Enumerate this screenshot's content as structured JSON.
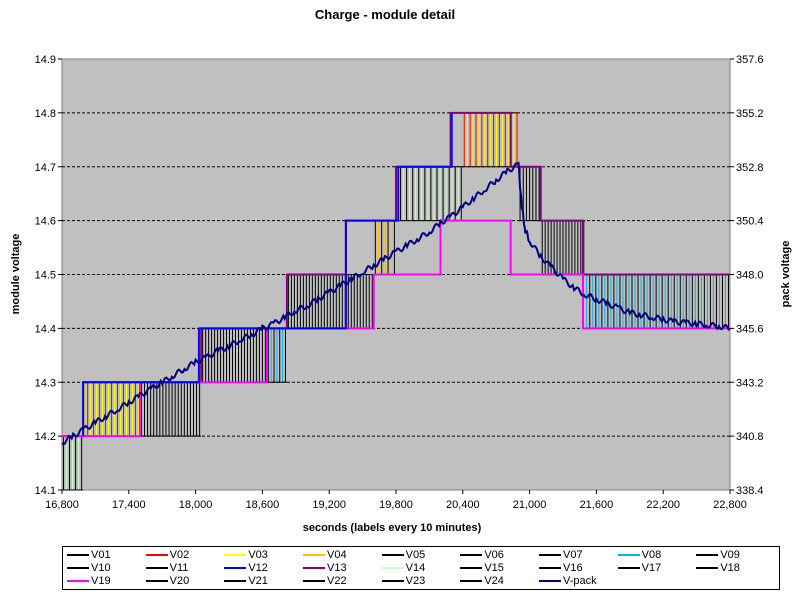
{
  "chart_data": {
    "type": "line",
    "title": "Charge - module detail",
    "xlabel": "seconds (labels every 10 minutes)",
    "ylabel": "module voltage",
    "y2label": "pack voltage",
    "xlim": [
      16800,
      22800
    ],
    "ylim": [
      14.1,
      14.9
    ],
    "y2lim": [
      338.4,
      357.6
    ],
    "x_ticks": [
      "16,800",
      "17,400",
      "18,000",
      "18,600",
      "19,200",
      "19,800",
      "20,400",
      "21,000",
      "21,600",
      "22,200",
      "22,800"
    ],
    "y_ticks": [
      "14.1",
      "14.2",
      "14.3",
      "14.4",
      "14.5",
      "14.6",
      "14.7",
      "14.8",
      "14.9"
    ],
    "y2_ticks": [
      "338.4",
      "340.8",
      "343.2",
      "345.6",
      "348.0",
      "350.4",
      "352.8",
      "355.2",
      "357.6"
    ],
    "grid": "horizontal dashed",
    "background": "#c0c0c0",
    "legend_position": "bottom",
    "series": [
      {
        "name": "V01",
        "color": "#000000"
      },
      {
        "name": "V02",
        "color": "#ff0000"
      },
      {
        "name": "V03",
        "color": "#ffff00"
      },
      {
        "name": "V04",
        "color": "#ffc000"
      },
      {
        "name": "V05",
        "color": "#000000"
      },
      {
        "name": "V06",
        "color": "#000000"
      },
      {
        "name": "V07",
        "color": "#000000"
      },
      {
        "name": "V08",
        "color": "#00b0f0"
      },
      {
        "name": "V09",
        "color": "#000000"
      },
      {
        "name": "V10",
        "color": "#000000"
      },
      {
        "name": "V11",
        "color": "#000000"
      },
      {
        "name": "V12",
        "color": "#0000ff"
      },
      {
        "name": "V13",
        "color": "#800080"
      },
      {
        "name": "V14",
        "color": "#ccffcc"
      },
      {
        "name": "V15",
        "color": "#000000"
      },
      {
        "name": "V16",
        "color": "#000000"
      },
      {
        "name": "V17",
        "color": "#000000"
      },
      {
        "name": "V18",
        "color": "#000000"
      },
      {
        "name": "V19",
        "color": "#ff00ff"
      },
      {
        "name": "V20",
        "color": "#000000"
      },
      {
        "name": "V21",
        "color": "#000000"
      },
      {
        "name": "V22",
        "color": "#000000"
      },
      {
        "name": "V23",
        "color": "#000000"
      },
      {
        "name": "V24",
        "color": "#000000"
      },
      {
        "name": "V-pack",
        "color": "#000080"
      }
    ],
    "module_steps": [
      {
        "x_start": 16800,
        "x_end": 16990,
        "y": 14.2
      },
      {
        "x_start": 16990,
        "x_end": 17500,
        "y": 14.3
      },
      {
        "x_start": 17500,
        "x_end": 18050,
        "y": 14.3
      },
      {
        "x_start": 18050,
        "x_end": 18640,
        "y": 14.4
      },
      {
        "x_start": 18640,
        "x_end": 18820,
        "y": 14.4
      },
      {
        "x_start": 18820,
        "x_end": 19600,
        "y": 14.5
      },
      {
        "x_start": 19600,
        "x_end": 19800,
        "y": 14.6
      },
      {
        "x_start": 19800,
        "x_end": 20400,
        "y": 14.7
      },
      {
        "x_start": 20400,
        "x_end": 20900,
        "y": 14.8
      },
      {
        "x_start": 20900,
        "x_end": 21100,
        "y": 14.7
      },
      {
        "x_start": 21100,
        "x_end": 21500,
        "y": 14.6
      },
      {
        "x_start": 21500,
        "x_end": 22800,
        "y": 14.5
      }
    ],
    "envelope": [
      {
        "name": "V13",
        "color": "#800080",
        "points": [
          [
            16800,
            14.2
          ],
          [
            16990,
            14.2
          ],
          [
            16990,
            14.3
          ],
          [
            17500,
            14.3
          ],
          [
            18050,
            14.3
          ],
          [
            18050,
            14.4
          ],
          [
            18640,
            14.4
          ],
          [
            18820,
            14.4
          ],
          [
            18820,
            14.5
          ],
          [
            19350,
            14.5
          ],
          [
            19350,
            14.6
          ],
          [
            19800,
            14.6
          ],
          [
            19800,
            14.7
          ],
          [
            20290,
            14.7
          ],
          [
            20290,
            14.8
          ],
          [
            20830,
            14.8
          ],
          [
            20830,
            14.7
          ],
          [
            21100,
            14.7
          ],
          [
            21100,
            14.6
          ],
          [
            21480,
            14.6
          ],
          [
            21480,
            14.5
          ],
          [
            22800,
            14.5
          ]
        ]
      },
      {
        "name": "V19",
        "color": "#ff00ff",
        "points": [
          [
            16800,
            14.2
          ],
          [
            17500,
            14.2
          ],
          [
            17500,
            14.3
          ],
          [
            18640,
            14.3
          ],
          [
            18640,
            14.4
          ],
          [
            19600,
            14.4
          ],
          [
            19600,
            14.5
          ],
          [
            20200,
            14.5
          ],
          [
            20200,
            14.6
          ],
          [
            20830,
            14.6
          ],
          [
            20830,
            14.5
          ],
          [
            21480,
            14.5
          ],
          [
            21480,
            14.4
          ],
          [
            22800,
            14.4
          ]
        ]
      },
      {
        "name": "V12",
        "color": "#0000ff",
        "points": [
          [
            16990,
            14.2
          ],
          [
            16990,
            14.3
          ],
          [
            18030,
            14.3
          ],
          [
            18030,
            14.4
          ],
          [
            19350,
            14.4
          ],
          [
            19350,
            14.6
          ],
          [
            19820,
            14.6
          ],
          [
            19820,
            14.7
          ],
          [
            20300,
            14.7
          ],
          [
            20300,
            14.8
          ]
        ]
      }
    ],
    "vpack": [
      [
        16800,
        340.5
      ],
      [
        16900,
        340.8
      ],
      [
        17000,
        341.1
      ],
      [
        17100,
        341.4
      ],
      [
        17200,
        341.7
      ],
      [
        17300,
        342.0
      ],
      [
        17400,
        342.3
      ],
      [
        17500,
        342.6
      ],
      [
        17600,
        342.9
      ],
      [
        17700,
        343.2
      ],
      [
        17800,
        343.5
      ],
      [
        17900,
        343.8
      ],
      [
        18000,
        344.1
      ],
      [
        18100,
        344.3
      ],
      [
        18200,
        344.6
      ],
      [
        18300,
        344.8
      ],
      [
        18400,
        345.1
      ],
      [
        18500,
        345.3
      ],
      [
        18600,
        345.6
      ],
      [
        18700,
        345.8
      ],
      [
        18800,
        346.1
      ],
      [
        18900,
        346.4
      ],
      [
        19000,
        346.6
      ],
      [
        19100,
        346.9
      ],
      [
        19200,
        347.2
      ],
      [
        19300,
        347.5
      ],
      [
        19400,
        347.8
      ],
      [
        19500,
        348.1
      ],
      [
        19600,
        348.4
      ],
      [
        19700,
        348.7
      ],
      [
        19800,
        349.0
      ],
      [
        19900,
        349.3
      ],
      [
        20000,
        349.6
      ],
      [
        20100,
        349.9
      ],
      [
        20200,
        350.3
      ],
      [
        20300,
        350.6
      ],
      [
        20400,
        351.0
      ],
      [
        20500,
        351.4
      ],
      [
        20600,
        351.8
      ],
      [
        20700,
        352.2
      ],
      [
        20800,
        352.6
      ],
      [
        20900,
        352.9
      ],
      [
        20930,
        351.0
      ],
      [
        20960,
        350.0
      ],
      [
        21000,
        349.5
      ],
      [
        21100,
        348.8
      ],
      [
        21200,
        348.3
      ],
      [
        21300,
        347.8
      ],
      [
        21400,
        347.4
      ],
      [
        21500,
        347.1
      ],
      [
        21600,
        346.9
      ],
      [
        21700,
        346.7
      ],
      [
        21800,
        346.5
      ],
      [
        21900,
        346.3
      ],
      [
        22000,
        346.2
      ],
      [
        22100,
        346.1
      ],
      [
        22200,
        346.0
      ],
      [
        22300,
        345.9
      ],
      [
        22400,
        345.85
      ],
      [
        22500,
        345.8
      ],
      [
        22600,
        345.75
      ],
      [
        22700,
        345.7
      ],
      [
        22800,
        345.6
      ]
    ]
  }
}
